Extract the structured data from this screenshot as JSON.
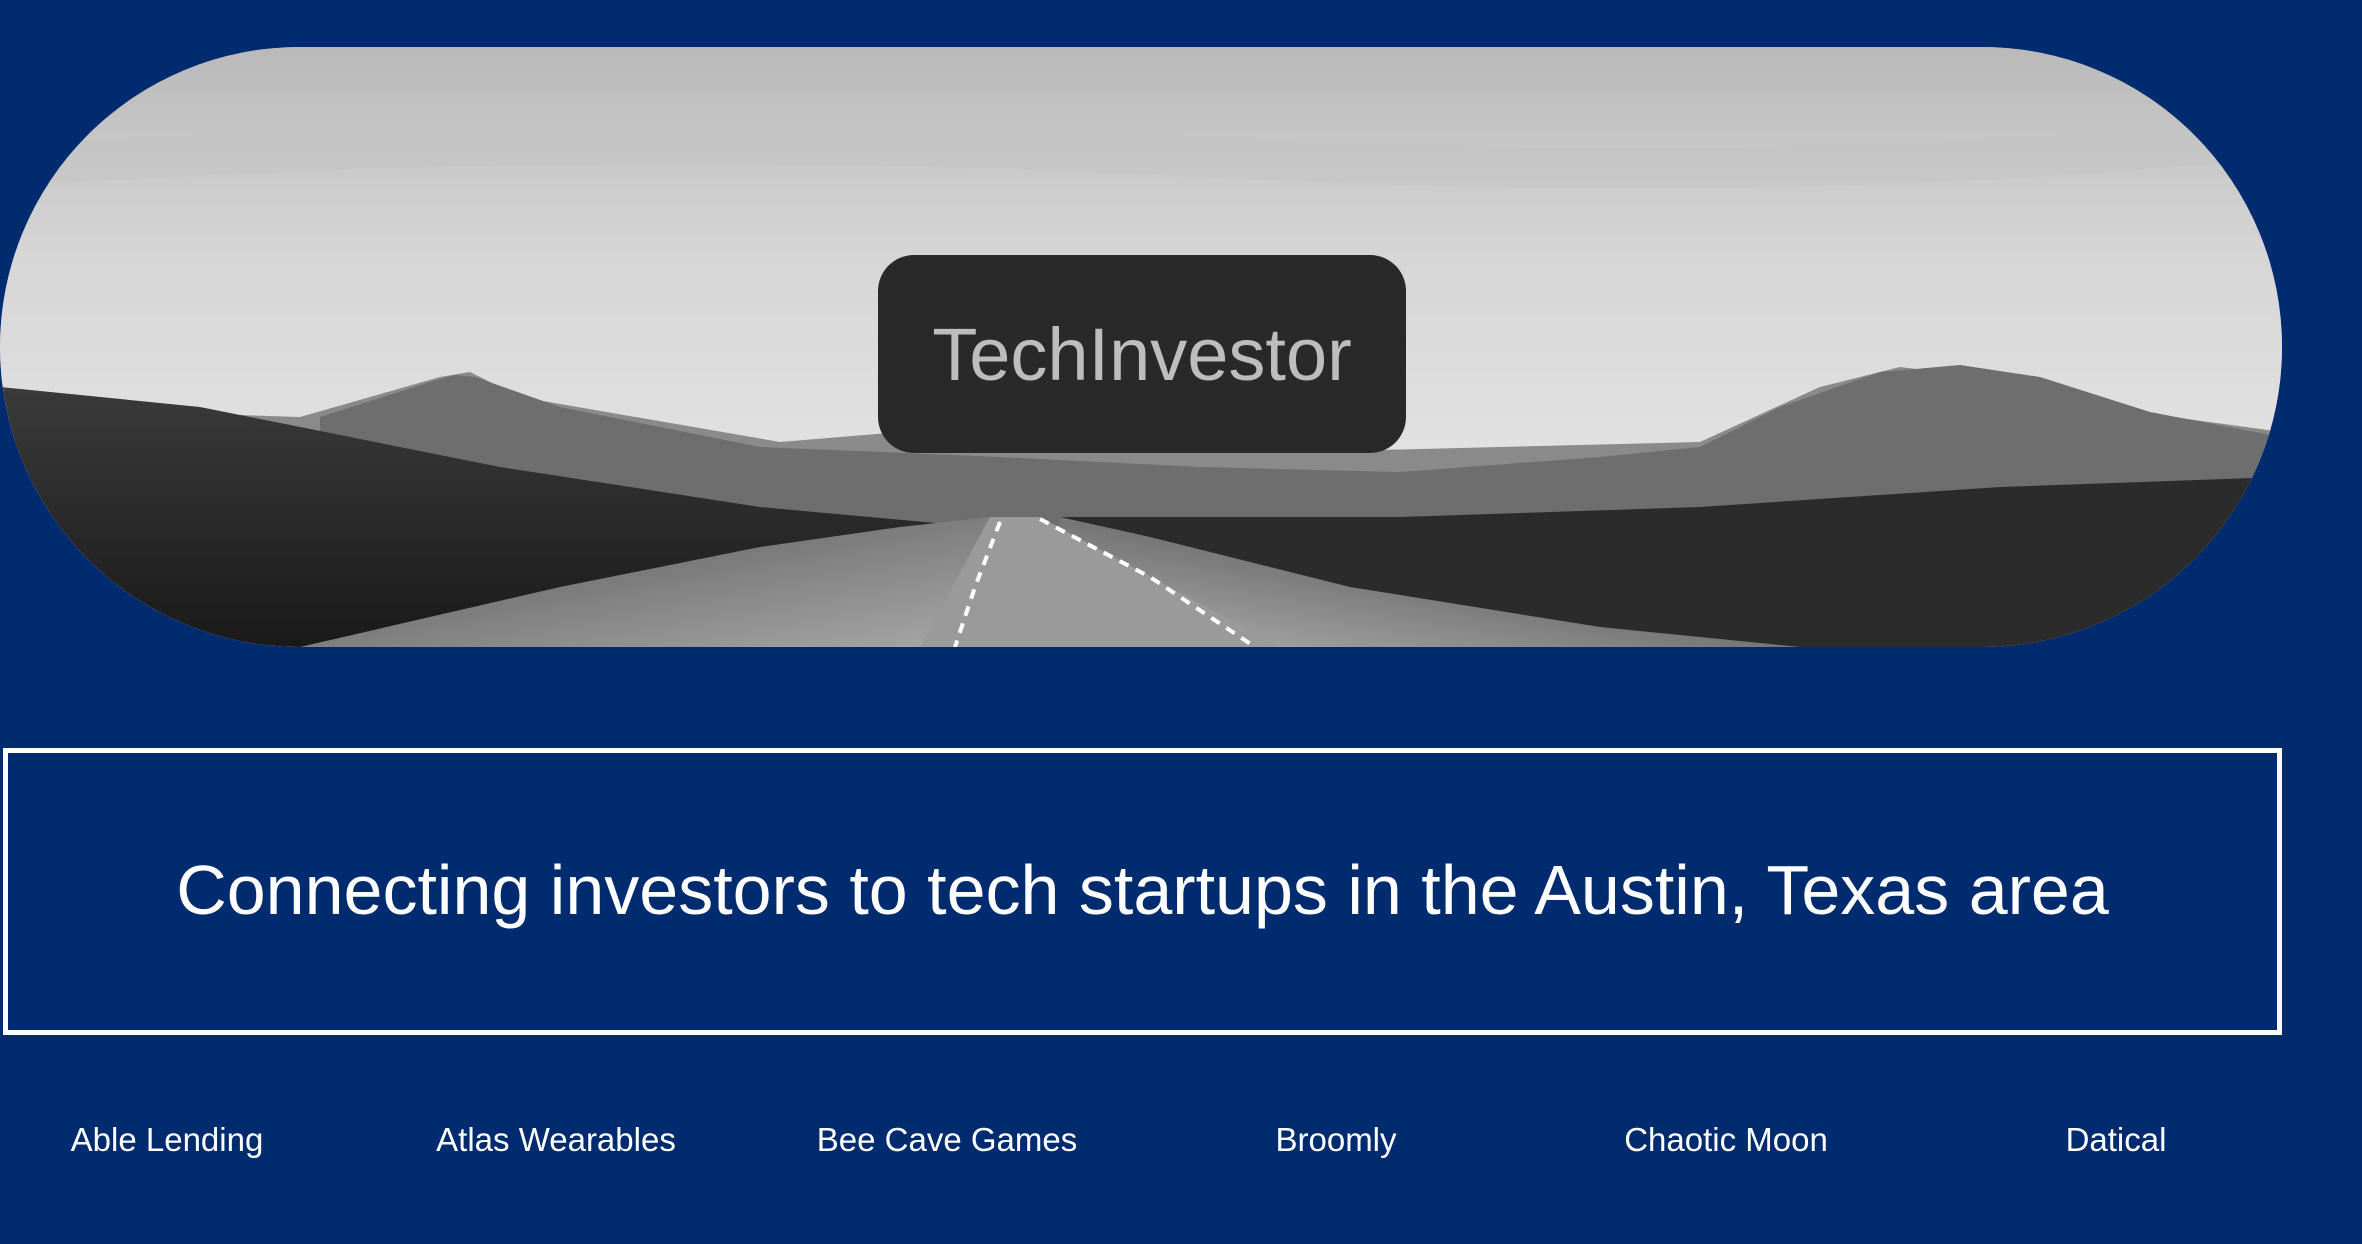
{
  "hero": {
    "logo_text": "TechInvestor"
  },
  "tagline": "Connecting investors to tech startups in the Austin, Texas area",
  "companies": [
    "Able Lending",
    "Atlas Wearables",
    "Bee Cave Games",
    "Broomly",
    "Chaotic Moon",
    "Datical"
  ],
  "colors": {
    "background": "#012b6f",
    "logo_box": "#292929",
    "logo_text": "#bdbdbd",
    "text": "#ffffff"
  }
}
